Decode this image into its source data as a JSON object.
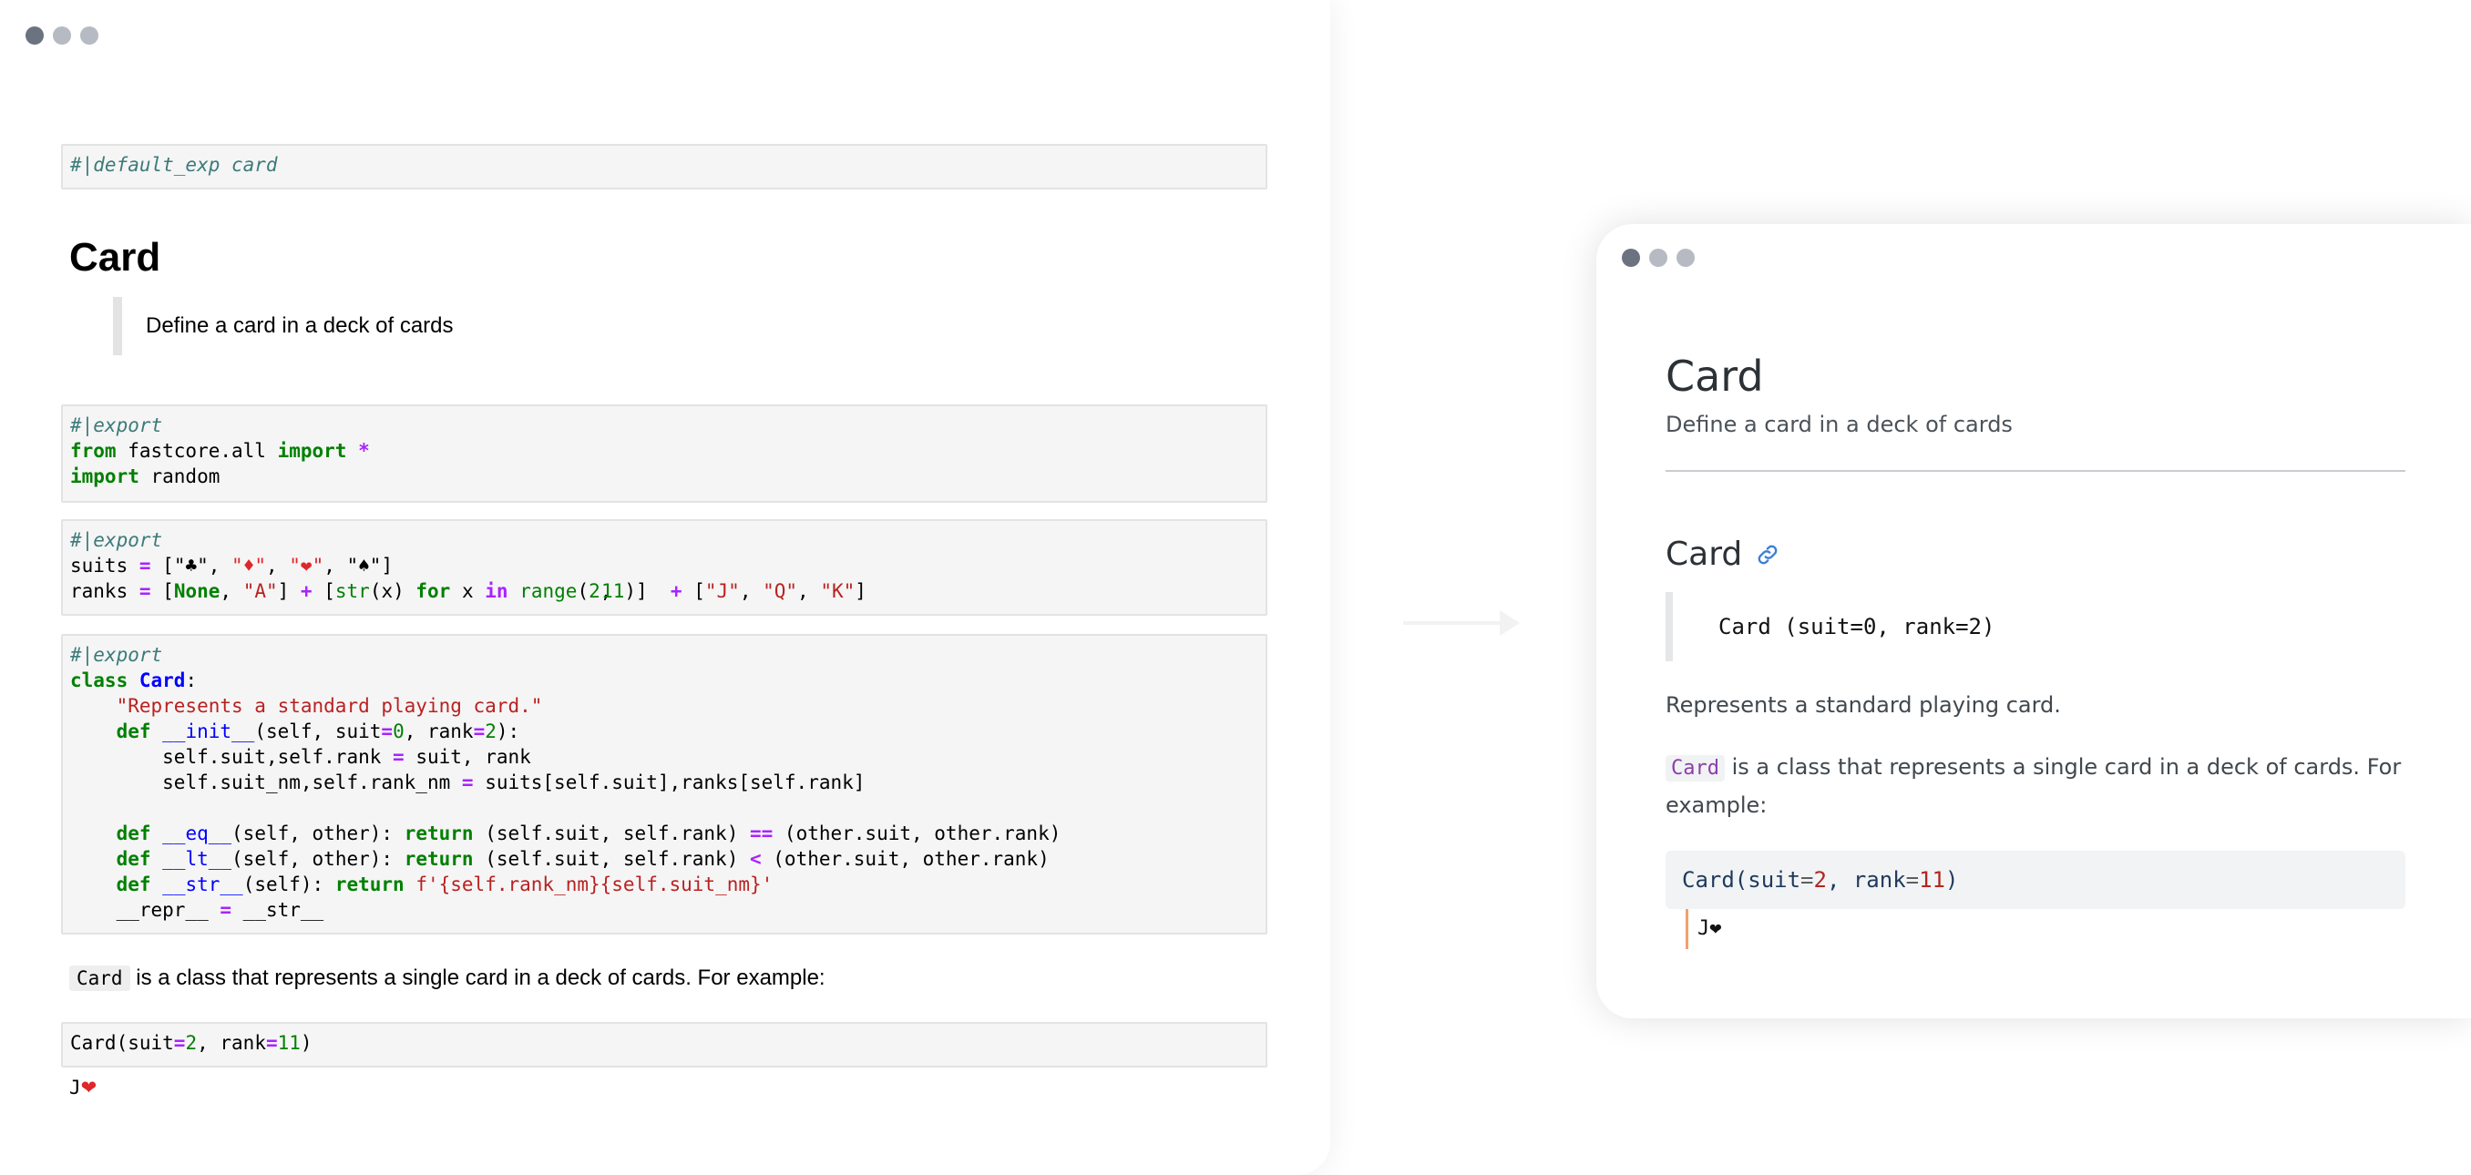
{
  "notebook": {
    "cell1": {
      "directive": "#|default_exp card"
    },
    "heading": "Card",
    "quote": "Define a card in a deck of cards",
    "cell2": {
      "directive": "#|export",
      "l2_kw1": "from",
      "l2_mod": " fastcore.all ",
      "l2_kw2": "import",
      "l2_sp": " ",
      "l2_star": "*",
      "l3_kw": "import",
      "l3_mod": " random"
    },
    "cell3": {
      "directive": "#|export",
      "suits_line_prefix": "suits ",
      "eq": "=",
      "suits_open": " [",
      "suit_club": "\"♣\"",
      "suit_diamond": "\"♦\"",
      "suit_heart": "\"❤\"",
      "suit_spade": "\"♠\"",
      "comma": ", ",
      "close": "]",
      "ranks_prefix": "ranks ",
      "ranks_open": " [",
      "none_kw": "None",
      "rank_a": "\"A\"",
      "ranks_mid": "] ",
      "plus": "+",
      "ranks_open2": " [",
      "str_fn": "str",
      "x_expr": "(x) ",
      "for_kw": "for",
      "x_var": " x ",
      "in_kw": "in",
      "sp": " ",
      "range_fn": "range",
      "paren_open": "(",
      "n2": "2",
      "n11": "11",
      "paren_close": ")]  ",
      "bracket_open": " [",
      "rank_j": "\"J\"",
      "rank_q": "\"Q\"",
      "rank_k": "\"K\""
    },
    "cell4": {
      "directive": "#|export",
      "class_kw": "class",
      "class_name": "Card",
      "colon": ":",
      "docstring": "\"Represents a standard playing card.\"",
      "def_kw": "def",
      "init_name": "__init__",
      "init_args_a": "(self, suit",
      "init_args_b": ", rank",
      "init_args_c": "):",
      "zero": "0",
      "two": "2",
      "assign1_a": "self.suit,self.rank ",
      "assign1_b": " suit, rank",
      "assign2_a": "self.suit_nm,self.rank_nm ",
      "assign2_b": " suits[self.suit],ranks[self.rank]",
      "eq_name": "__eq__",
      "lt_name": "__lt__",
      "str_name": "__str__",
      "other_args": "(self, other): ",
      "return_kw": "return",
      "tuple_self": " (self.suit, self.rank) ",
      "eqeq": "==",
      "lt": "<",
      "tuple_other": " (other.suit, other.rank)",
      "str_args": "(self): ",
      "fstring": " f'{self.rank_nm}{self.suit_nm}'",
      "repr_a": "__repr__ ",
      "repr_b": " __str__"
    },
    "para_code": "Card",
    "para_text": " is a class that represents a single card in a deck of cards. For example:",
    "cell5": {
      "call_a": "Card(suit",
      "call_b": "2",
      "call_c": ", rank",
      "call_d": "11",
      "call_e": ")"
    },
    "output_text": "J",
    "output_heart": "❤"
  },
  "doc": {
    "title": "Card",
    "subtitle": "Define a card in a deck of cards",
    "h2": "Card",
    "signature": "Card (suit=0, rank=2)",
    "p1": "Represents a standard playing card.",
    "p2_code": "Card",
    "p2_text": " is a class that represents a single card in a deck of cards. For example:",
    "code_a": "Card(suit",
    "code_eq": "=",
    "code_n1": "2",
    "code_b": ", rank",
    "code_n2": "11",
    "code_c": ")",
    "output": "J❤"
  },
  "icons": [
    "link-icon",
    "right-arrow-icon"
  ],
  "colors": {
    "accent_link": "#3b7fd4",
    "keyword_green": "#008000",
    "string_red": "#ba2121",
    "operator_purple": "#aa22ff"
  }
}
